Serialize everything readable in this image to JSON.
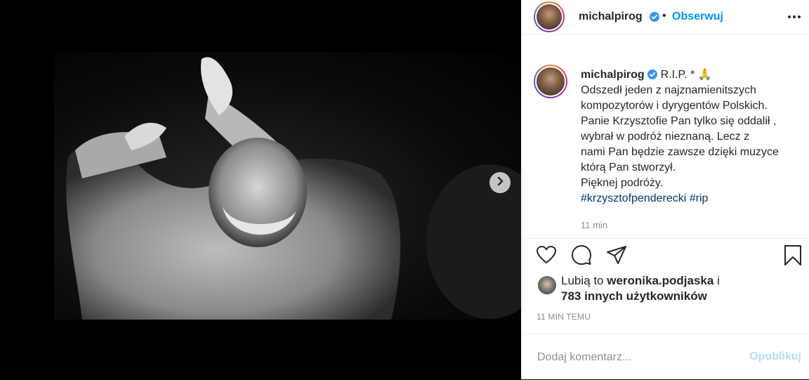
{
  "post": {
    "username": "michalpirog",
    "follow_label": "Obserwuj",
    "caption_username": "michalpirog",
    "caption_lines": [
      "R.I.P. * 🙏",
      "Odszedł jeden z najznamienitszych",
      "kompozytorów i dyrygentów Polskich.",
      "Panie Krzysztofie Pan tylko się oddalił ,",
      "wybrał w podróż nieznaną. Lecz z",
      "nami Pan będzie zawsze dzięki muzyce",
      "którą Pan stworzył.",
      "Pięknej podróży."
    ],
    "hashtags": [
      "#krzysztofpenderecki",
      "#rip"
    ],
    "caption_time": "11 min",
    "likes_prefix": "Lubią to",
    "likes_user": "weronika.podjaska",
    "likes_conjunction": "i",
    "likes_others": "783 innych użytkowników",
    "post_time": "11 MIN TEMU",
    "comment_placeholder": "Dodaj komentarz...",
    "publish_label": "Opublikuj"
  },
  "colors": {
    "accent": "#0095f6",
    "publish_disabled": "#b2dffc",
    "hashtag": "#00376b",
    "verified": "#3897f0",
    "muted": "#8e8e8e"
  },
  "icons": {
    "next": "chevron-right-icon",
    "more": "more-horizontal-icon",
    "like": "heart-icon",
    "comment": "comment-icon",
    "share": "paper-plane-icon",
    "save": "bookmark-icon",
    "verified": "verified-badge-icon"
  }
}
